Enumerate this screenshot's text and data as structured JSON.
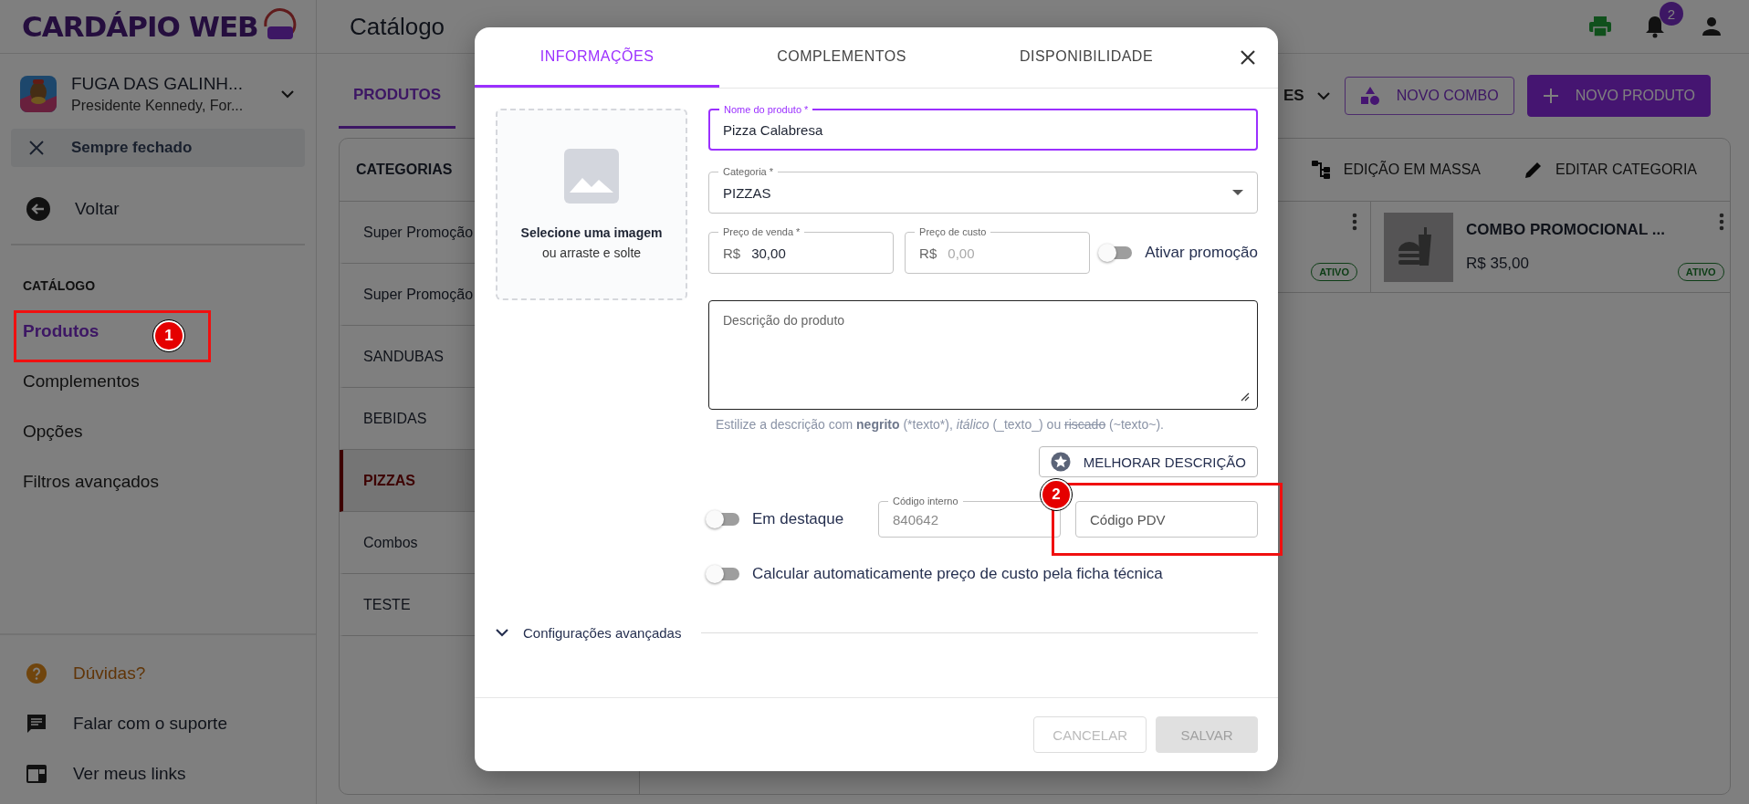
{
  "logo": {
    "text": "CARDÁPIO WEB"
  },
  "store": {
    "name": "FUGA DAS GALINH...",
    "address": "Presidente Kennedy, For..."
  },
  "status_chip": {
    "label": "Sempre fechado"
  },
  "back_link": {
    "label": "Voltar"
  },
  "sidebar": {
    "section": "CATÁLOGO",
    "items": [
      {
        "label": "Produtos",
        "selected": true
      },
      {
        "label": "Complementos",
        "selected": false
      },
      {
        "label": "Opções",
        "selected": false
      },
      {
        "label": "Filtros avançados",
        "selected": false
      }
    ],
    "footer_items": [
      {
        "label": "Dúvidas?",
        "kind": "help"
      },
      {
        "label": "Falar com o suporte",
        "kind": "chat"
      },
      {
        "label": "Ver meus links",
        "kind": "links"
      }
    ]
  },
  "header": {
    "title": "Catálogo",
    "notifications": "2"
  },
  "page_tabs": [
    {
      "label": "PRODUTOS",
      "selected": true
    }
  ],
  "filter_dropdown": {
    "label": "ES"
  },
  "actions": [
    {
      "label": "NOVO COMBO",
      "kind": "outlined"
    },
    {
      "label": "NOVO PRODUTO",
      "kind": "filled"
    }
  ],
  "categories": {
    "title": "CATEGORIAS",
    "items": [
      {
        "label": "Super Promoção",
        "selected": false
      },
      {
        "label": "Super Promoção",
        "selected": false
      },
      {
        "label": "SANDUBAS",
        "selected": false
      },
      {
        "label": "BEBIDAS",
        "selected": false
      },
      {
        "label": "PIZZAS",
        "selected": true
      },
      {
        "label": "Combos",
        "selected": false
      },
      {
        "label": "TESTE",
        "selected": false
      }
    ]
  },
  "category_actions": [
    {
      "label": "EDIÇÃO EM MASSA",
      "kind": "bulk"
    },
    {
      "label": "EDITAR CATEGORIA",
      "kind": "edit"
    }
  ],
  "products": [
    {
      "status": "ATIVO"
    },
    {
      "name": "COMBO PROMOCIONAL ...",
      "price": "R$ 35,00",
      "status": "ATIVO"
    }
  ],
  "modal": {
    "tabs": [
      {
        "label": "INFORMAÇÕES",
        "selected": true
      },
      {
        "label": "COMPLEMENTOS",
        "selected": false
      },
      {
        "label": "DISPONIBILIDADE",
        "selected": false
      }
    ],
    "image_drop": {
      "title": "Selecione uma imagem",
      "subtitle": "ou arraste e solte"
    },
    "name_field": {
      "label": "Nome do produto *",
      "value": "Pizza Calabresa",
      "focused": true
    },
    "category_field": {
      "label": "Categoria *",
      "value": "PIZZAS"
    },
    "sale_price": {
      "label": "Preço de venda *",
      "prefix": "R$",
      "value": "30,00"
    },
    "cost_price": {
      "label": "Preço de custo",
      "prefix": "R$",
      "placeholder": "0,00"
    },
    "promo_toggle": {
      "label": "Ativar promoção",
      "on": false
    },
    "description": {
      "placeholder": "Descrição do produto"
    },
    "helper": [
      {
        "text": "Estilize a descrição com ",
        "kind": "plain"
      },
      {
        "text": "negrito",
        "kind": "bold"
      },
      {
        "text": " (*texto*), ",
        "kind": "plain"
      },
      {
        "text": "itálico",
        "kind": "italic"
      },
      {
        "text": " (_texto_) ou ",
        "kind": "plain"
      },
      {
        "text": "riscado",
        "kind": "strike"
      },
      {
        "text": " (~texto~).",
        "kind": "plain"
      }
    ],
    "improve_button": {
      "label": "MELHORAR DESCRIÇÃO"
    },
    "featured_toggle": {
      "label": "Em destaque",
      "on": false
    },
    "internal_code": {
      "label": "Código interno",
      "value": "840642",
      "disabled": true
    },
    "pdv_code": {
      "placeholder": "Código PDV"
    },
    "auto_cost_toggle": {
      "label": "Calcular automaticamente preço de custo pela ficha técnica",
      "on": false
    },
    "advanced": {
      "label": "Configurações avançadas",
      "expanded": false
    },
    "buttons": [
      {
        "label": "CANCELAR",
        "kind": "outlined",
        "disabled": true
      },
      {
        "label": "SALVAR",
        "kind": "filled",
        "disabled": true
      }
    ]
  },
  "annotations": [
    {
      "number": "1"
    },
    {
      "number": "2"
    }
  ]
}
